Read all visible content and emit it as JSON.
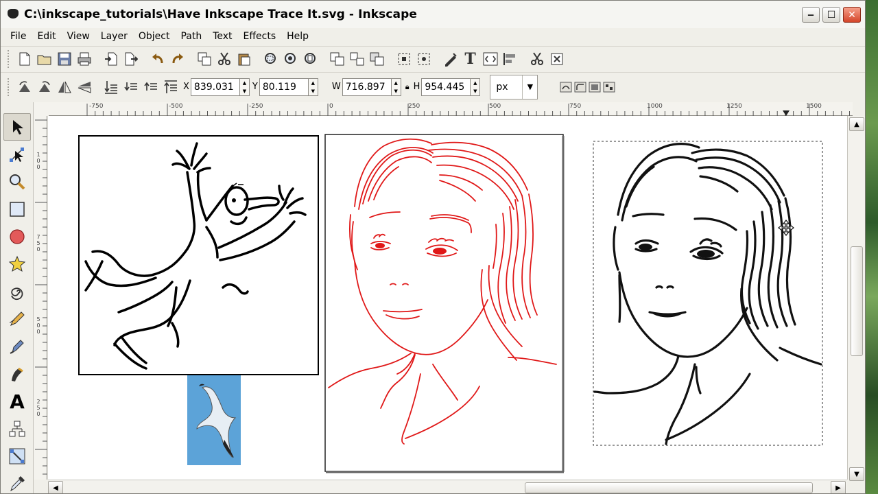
{
  "window": {
    "title": "C:\\inkscape_tutorials\\Have Inkscape Trace It.svg - Inkscape"
  },
  "menu": [
    "File",
    "Edit",
    "View",
    "Layer",
    "Object",
    "Path",
    "Text",
    "Effects",
    "Help"
  ],
  "toolbar_main": {
    "icons": [
      "new-document-icon",
      "open-icon",
      "save-icon",
      "print-icon",
      "import-icon",
      "export-icon",
      "undo-icon",
      "redo-icon",
      "duplicate-icon",
      "cut-icon",
      "paste-icon",
      "zoom-selection-icon",
      "zoom-drawing-icon",
      "zoom-page-icon",
      "group-icon",
      "ungroup-icon",
      "clone-icon",
      "fill-stroke-icon",
      "node-edit-icon",
      "fill-stroke-dialog-icon",
      "text-tool-icon",
      "xml-editor-icon",
      "align-icon",
      "cut-path-icon",
      "inkscape-preferences-icon"
    ]
  },
  "selector_toolbar": {
    "x_label": "X",
    "x_value": "839.031",
    "y_label": "Y",
    "y_value": "80.119",
    "w_label": "W",
    "w_value": "716.897",
    "h_label": "H",
    "h_value": "954.445",
    "unit": "px"
  },
  "ruler": {
    "top_labels": [
      "-750",
      "-500",
      "-250",
      "0",
      "250",
      "500",
      "750",
      "1000",
      "1250",
      "1500"
    ],
    "left_labels": [
      "1",
      "0",
      "0",
      "7",
      "5",
      "0",
      "5",
      "0",
      "0",
      "2",
      "5",
      "0"
    ]
  },
  "tools": [
    "selector-tool",
    "node-tool",
    "zoom-tool",
    "rectangle-tool",
    "ellipse-tool",
    "star-tool",
    "spiral-tool",
    "pencil-tool",
    "pen-tool",
    "calligraphy-tool",
    "text-tool",
    "connector-tool",
    "gradient-tool",
    "dropper-tool"
  ],
  "colors": {
    "red_trace": "#e01818",
    "black_trace": "#111111",
    "gull_bg": "#5ca3d8"
  }
}
